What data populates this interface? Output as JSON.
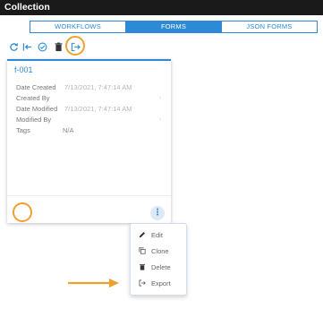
{
  "window": {
    "title": "Collection"
  },
  "tabs": [
    {
      "label": "WORKFLOWS",
      "active": false
    },
    {
      "label": "FORMS",
      "active": true
    },
    {
      "label": "JSON FORMS",
      "active": false
    }
  ],
  "toolbar": {
    "icons": [
      "refresh-icon",
      "import-icon",
      "check-circle-icon",
      "trash-icon",
      "export-icon"
    ]
  },
  "card": {
    "title": "f-001",
    "fields": [
      {
        "label": "Date Created",
        "value": "7/13/2021, 7:47:14 AM"
      },
      {
        "label": "Created By",
        "value": ""
      },
      {
        "label": "Date Modified",
        "value": "7/13/2021, 7:47:14 AM"
      },
      {
        "label": "Modified By",
        "value": ""
      },
      {
        "label": "Tags",
        "value": "N/A"
      }
    ],
    "more_label": "⋮"
  },
  "menu": {
    "items": [
      {
        "label": "Edit",
        "icon": "pencil-icon"
      },
      {
        "label": "Clone",
        "icon": "copy-icon"
      },
      {
        "label": "Delete",
        "icon": "trash-icon"
      },
      {
        "label": "Export",
        "icon": "export-icon"
      }
    ]
  },
  "colors": {
    "accent": "#2e8ad6",
    "highlight": "#f0a030",
    "titlebar": "#1a1a1a"
  }
}
